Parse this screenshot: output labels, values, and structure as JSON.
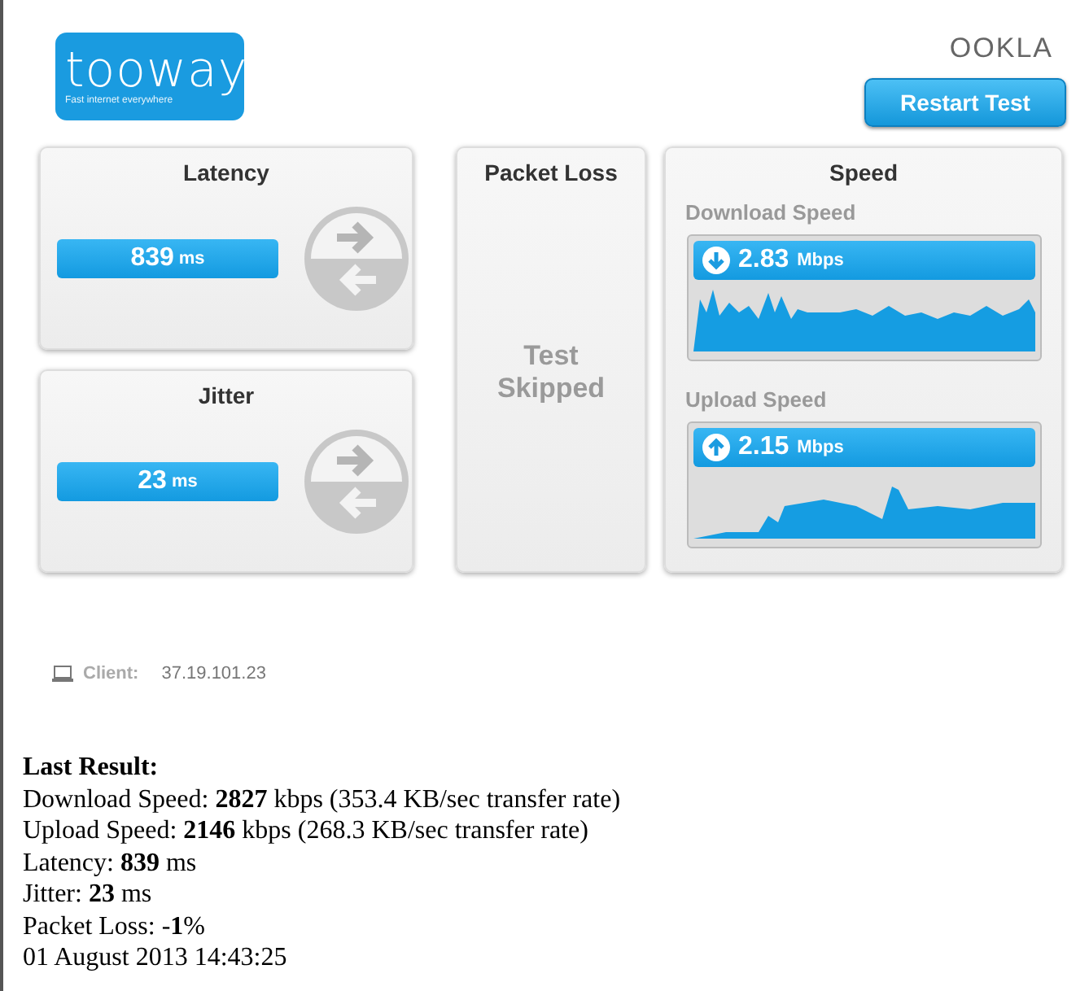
{
  "header": {
    "logo": {
      "name": "tooway",
      "tagline": "Fast internet everywhere"
    },
    "brand": "OOKLA",
    "restart_button": "Restart Test"
  },
  "latency": {
    "title": "Latency",
    "value": "839",
    "unit": "ms"
  },
  "jitter": {
    "title": "Jitter",
    "value": "23",
    "unit": "ms"
  },
  "packet_loss": {
    "title": "Packet Loss",
    "status": "Test Skipped"
  },
  "speed": {
    "title": "Speed",
    "tests": [
      {
        "kind": "download",
        "label": "Download Speed",
        "value": "2.83",
        "unit": "Mbps"
      },
      {
        "kind": "upload",
        "label": "Upload Speed",
        "value": "2.15",
        "unit": "Mbps"
      }
    ]
  },
  "client": {
    "label": "Client:",
    "address": "37.19.101.23"
  },
  "last_result": {
    "title": "Last Result:",
    "lines": [
      "Download Speed: **2827** kbps (353.4 KB/sec transfer rate)",
      "Upload Speed: **2146** kbps (268.3 KB/sec transfer rate)",
      "Latency: **839** ms",
      "Jitter: **23** ms",
      "Packet Loss: -**1**%",
      "01 August 2013 14:43:25"
    ]
  }
}
